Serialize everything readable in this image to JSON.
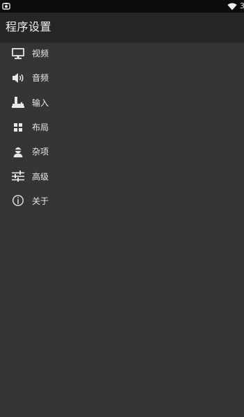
{
  "status_bar": {
    "left_icon": "screenshot-icon",
    "wifi_icon": "wifi-icon",
    "right_text": "3"
  },
  "app_bar": {
    "title": "程序设置"
  },
  "menu": {
    "items": [
      {
        "label": "视频",
        "icon": "monitor-icon"
      },
      {
        "label": "音频",
        "icon": "speaker-icon"
      },
      {
        "label": "输入",
        "icon": "joystick-icon"
      },
      {
        "label": "布局",
        "icon": "grid-icon"
      },
      {
        "label": "杂项",
        "icon": "person-icon"
      },
      {
        "label": "高级",
        "icon": "sliders-icon"
      },
      {
        "label": "关于",
        "icon": "info-icon"
      }
    ]
  },
  "colors": {
    "background": "#353535",
    "app_bar": "#262626",
    "status_bar": "#0d0d0d",
    "text": "#eaeaea"
  }
}
